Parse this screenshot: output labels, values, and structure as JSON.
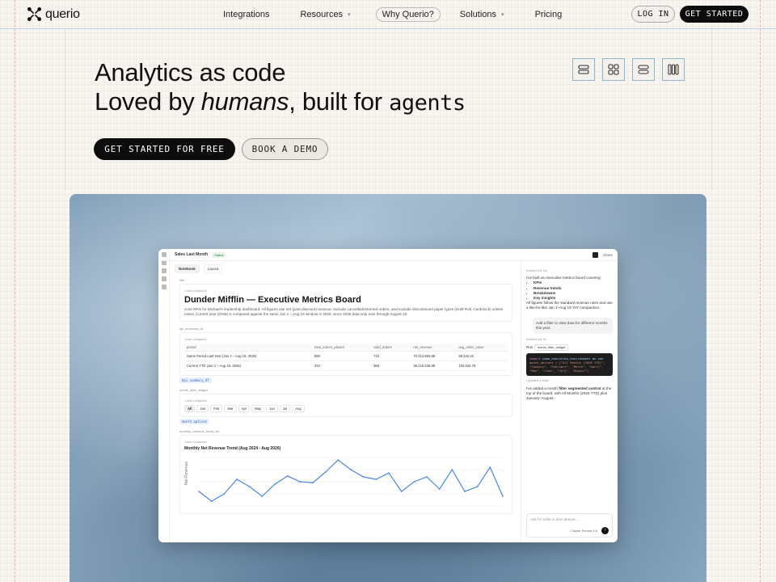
{
  "nav": {
    "logo_text": "querio",
    "links": [
      {
        "label": "Integrations"
      },
      {
        "label": "Resources",
        "chevron": "▾"
      },
      {
        "label": "Why Querio?"
      },
      {
        "label": "Solutions",
        "chevron": "▾"
      },
      {
        "label": "Pricing"
      }
    ],
    "login_label": "LOG IN",
    "get_started_label": "GET STARTED"
  },
  "hero": {
    "line1": "Analytics as code",
    "line2_prefix": "Loved by ",
    "line2_em": "humans",
    "line2_mid": ", built for ",
    "line2_mono": "agents",
    "cta_primary": "GET STARTED FOR FREE",
    "cta_secondary": "BOOK A DEMO",
    "layout_icons": [
      "layout-stack-icon",
      "layout-grid-icon",
      "layout-rows-icon",
      "layout-columns-icon"
    ]
  },
  "app": {
    "title": "Sales Last Month",
    "status": "Status",
    "share": "Share",
    "tabs": [
      "Notebook",
      "Layout"
    ],
    "cells": {
      "title_label": "title",
      "collapsed": "Code collapsed",
      "board_title": "Dunder Mifflin — Executive Metrics Board",
      "board_desc": "Core KPIs for Michael's leadership dashboard. All figures use net (post-discount) revenue, exclude cancelled/returned orders, and exclude discontinued paper types (Kraft Roll, Cardstock) unless noted. Current year (2026) is compared against the same Jan 1 – Aug 19 window in 2025, since 2026 data only runs through August 19.",
      "kpi_label": "kpi_summary_df",
      "kpi_headers": [
        "period",
        "total_orders_placed",
        "valid_orders",
        "net_revenue",
        "avg_order_value"
      ],
      "kpi_rows": [
        [
          "Same Period Last Year (Jan 1 – Aug 19, 2025)",
          "880",
          "715",
          "70,314,883.88",
          "98,342.22"
        ],
        [
          "Current YTD (Jan 1 – Aug 19, 2026)",
          "434",
          "368",
          "38,215,038.89",
          "103,834.79"
        ]
      ],
      "kpi_chip": "kpi_summary_df",
      "filter_label": "month_filter_widget",
      "months": [
        "All",
        "Jan",
        "Feb",
        "Mar",
        "Apr",
        "May",
        "Jun",
        "Jul",
        "Aug"
      ],
      "filter_chip": "month_options",
      "chart_label": "monthly_revenue_trend_viz",
      "chart_title": "Monthly Net Revenue Trend (Aug 2024 - Aug 2026)",
      "chart_ylabel": "Net Revenue"
    },
    "chat": {
      "worked_1": "Worked for 2m",
      "intro": "I've built an executive metrics board covering:",
      "bullets": [
        "KPIs",
        "Revenue trends",
        "Breakdowns",
        "Key insights"
      ],
      "summary": "All figures follow the standard revenue rules and use a like-for-like Jan 1–Aug 19 YoY comparison.",
      "user_msg": "Add a filter to view data for different months this year.",
      "worked_2": "Worked for 9s",
      "run_label": "Run",
      "run_chip": "month_filter_widget",
      "code_line1_kw": "import",
      "code_line1_rest": " como_execution_environment as cee",
      "code_line2": "month_options = [\"All Months (2026 YTD)\", \"January\", \"February\", \"March\", \"April\", \"May\", \"June\", \"July\", \"August\"]",
      "updated": "Updated 4 cells",
      "reply_1": "I've added a month ",
      "reply_bold": "filter segmented control",
      "reply_2": " at the top of the board, with All Months (2026 YTD) plus January–August.",
      "input_placeholder": "Ask for edits or dive deeper...",
      "model": "Claude Sonnet 4.6",
      "send": "↑"
    }
  },
  "colors": {
    "background": "#f8f4ef",
    "dark_button": "#0d0d0d",
    "accent_blue": "#8fb7c9",
    "guide_pink": "#e8a6b8",
    "chart_line": "#4a86e8"
  },
  "chart_data": {
    "type": "line",
    "title": "Monthly Net Revenue Trend (Aug 2024 - Aug 2026)",
    "xlabel": "",
    "ylabel": "Net Revenue",
    "values": [
      30,
      10,
      25,
      55,
      40,
      20,
      45,
      62,
      50,
      48,
      70,
      95,
      75,
      60,
      55,
      68,
      30,
      50,
      60,
      35,
      75,
      30,
      40,
      80,
      20
    ],
    "ylim": [
      0,
      100
    ]
  }
}
